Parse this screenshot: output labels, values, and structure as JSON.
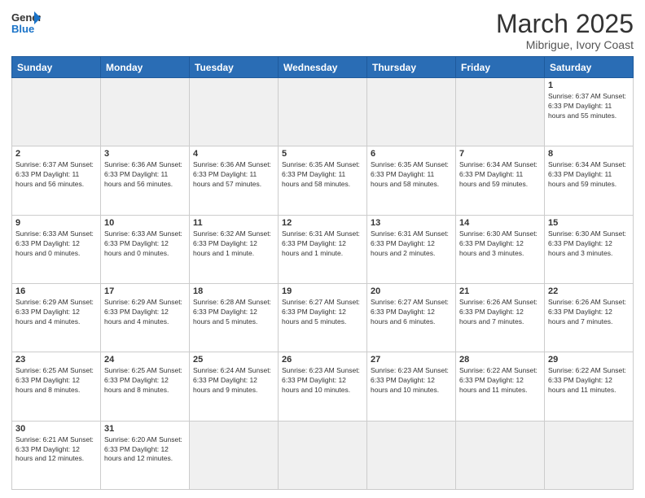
{
  "header": {
    "logo_general": "General",
    "logo_blue": "Blue",
    "month_title": "March 2025",
    "location": "Mibrigue, Ivory Coast"
  },
  "days_of_week": [
    "Sunday",
    "Monday",
    "Tuesday",
    "Wednesday",
    "Thursday",
    "Friday",
    "Saturday"
  ],
  "weeks": [
    [
      {
        "day": "",
        "info": ""
      },
      {
        "day": "",
        "info": ""
      },
      {
        "day": "",
        "info": ""
      },
      {
        "day": "",
        "info": ""
      },
      {
        "day": "",
        "info": ""
      },
      {
        "day": "",
        "info": ""
      },
      {
        "day": "1",
        "info": "Sunrise: 6:37 AM\nSunset: 6:33 PM\nDaylight: 11 hours\nand 55 minutes."
      }
    ],
    [
      {
        "day": "2",
        "info": "Sunrise: 6:37 AM\nSunset: 6:33 PM\nDaylight: 11 hours\nand 56 minutes."
      },
      {
        "day": "3",
        "info": "Sunrise: 6:36 AM\nSunset: 6:33 PM\nDaylight: 11 hours\nand 56 minutes."
      },
      {
        "day": "4",
        "info": "Sunrise: 6:36 AM\nSunset: 6:33 PM\nDaylight: 11 hours\nand 57 minutes."
      },
      {
        "day": "5",
        "info": "Sunrise: 6:35 AM\nSunset: 6:33 PM\nDaylight: 11 hours\nand 58 minutes."
      },
      {
        "day": "6",
        "info": "Sunrise: 6:35 AM\nSunset: 6:33 PM\nDaylight: 11 hours\nand 58 minutes."
      },
      {
        "day": "7",
        "info": "Sunrise: 6:34 AM\nSunset: 6:33 PM\nDaylight: 11 hours\nand 59 minutes."
      },
      {
        "day": "8",
        "info": "Sunrise: 6:34 AM\nSunset: 6:33 PM\nDaylight: 11 hours\nand 59 minutes."
      }
    ],
    [
      {
        "day": "9",
        "info": "Sunrise: 6:33 AM\nSunset: 6:33 PM\nDaylight: 12 hours\nand 0 minutes."
      },
      {
        "day": "10",
        "info": "Sunrise: 6:33 AM\nSunset: 6:33 PM\nDaylight: 12 hours\nand 0 minutes."
      },
      {
        "day": "11",
        "info": "Sunrise: 6:32 AM\nSunset: 6:33 PM\nDaylight: 12 hours\nand 1 minute."
      },
      {
        "day": "12",
        "info": "Sunrise: 6:31 AM\nSunset: 6:33 PM\nDaylight: 12 hours\nand 1 minute."
      },
      {
        "day": "13",
        "info": "Sunrise: 6:31 AM\nSunset: 6:33 PM\nDaylight: 12 hours\nand 2 minutes."
      },
      {
        "day": "14",
        "info": "Sunrise: 6:30 AM\nSunset: 6:33 PM\nDaylight: 12 hours\nand 3 minutes."
      },
      {
        "day": "15",
        "info": "Sunrise: 6:30 AM\nSunset: 6:33 PM\nDaylight: 12 hours\nand 3 minutes."
      }
    ],
    [
      {
        "day": "16",
        "info": "Sunrise: 6:29 AM\nSunset: 6:33 PM\nDaylight: 12 hours\nand 4 minutes."
      },
      {
        "day": "17",
        "info": "Sunrise: 6:29 AM\nSunset: 6:33 PM\nDaylight: 12 hours\nand 4 minutes."
      },
      {
        "day": "18",
        "info": "Sunrise: 6:28 AM\nSunset: 6:33 PM\nDaylight: 12 hours\nand 5 minutes."
      },
      {
        "day": "19",
        "info": "Sunrise: 6:27 AM\nSunset: 6:33 PM\nDaylight: 12 hours\nand 5 minutes."
      },
      {
        "day": "20",
        "info": "Sunrise: 6:27 AM\nSunset: 6:33 PM\nDaylight: 12 hours\nand 6 minutes."
      },
      {
        "day": "21",
        "info": "Sunrise: 6:26 AM\nSunset: 6:33 PM\nDaylight: 12 hours\nand 7 minutes."
      },
      {
        "day": "22",
        "info": "Sunrise: 6:26 AM\nSunset: 6:33 PM\nDaylight: 12 hours\nand 7 minutes."
      }
    ],
    [
      {
        "day": "23",
        "info": "Sunrise: 6:25 AM\nSunset: 6:33 PM\nDaylight: 12 hours\nand 8 minutes."
      },
      {
        "day": "24",
        "info": "Sunrise: 6:25 AM\nSunset: 6:33 PM\nDaylight: 12 hours\nand 8 minutes."
      },
      {
        "day": "25",
        "info": "Sunrise: 6:24 AM\nSunset: 6:33 PM\nDaylight: 12 hours\nand 9 minutes."
      },
      {
        "day": "26",
        "info": "Sunrise: 6:23 AM\nSunset: 6:33 PM\nDaylight: 12 hours\nand 10 minutes."
      },
      {
        "day": "27",
        "info": "Sunrise: 6:23 AM\nSunset: 6:33 PM\nDaylight: 12 hours\nand 10 minutes."
      },
      {
        "day": "28",
        "info": "Sunrise: 6:22 AM\nSunset: 6:33 PM\nDaylight: 12 hours\nand 11 minutes."
      },
      {
        "day": "29",
        "info": "Sunrise: 6:22 AM\nSunset: 6:33 PM\nDaylight: 12 hours\nand 11 minutes."
      }
    ],
    [
      {
        "day": "30",
        "info": "Sunrise: 6:21 AM\nSunset: 6:33 PM\nDaylight: 12 hours\nand 12 minutes."
      },
      {
        "day": "31",
        "info": "Sunrise: 6:20 AM\nSunset: 6:33 PM\nDaylight: 12 hours\nand 12 minutes."
      },
      {
        "day": "",
        "info": ""
      },
      {
        "day": "",
        "info": ""
      },
      {
        "day": "",
        "info": ""
      },
      {
        "day": "",
        "info": ""
      },
      {
        "day": "",
        "info": ""
      }
    ]
  ]
}
